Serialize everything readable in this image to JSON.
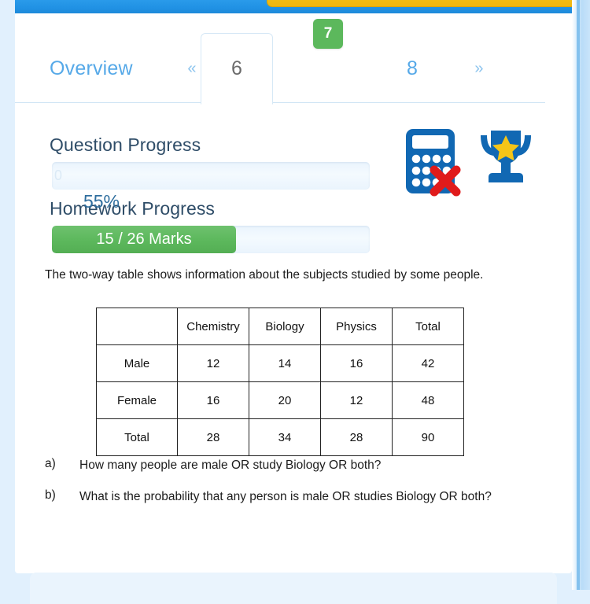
{
  "header": {
    "action_button": "",
    "bar_color": "#2091e4",
    "button_color": "#f0b90f"
  },
  "tabs": {
    "overview_label": "Overview",
    "prev_label": "«",
    "next_label": "»",
    "pages": [
      {
        "label": "6",
        "state": "active"
      },
      {
        "label": "7",
        "state": "badge"
      },
      {
        "label": "8",
        "state": "normal"
      }
    ],
    "active_color": "#6b6b6b",
    "link_color": "#56a9e8",
    "badge_color": "#5cb85c"
  },
  "progress": {
    "question": {
      "label": "Question Progress",
      "value_text": "0",
      "percent": 0
    },
    "homework": {
      "label": "Homework Progress",
      "value_text": "15 / 26 Marks",
      "marks_earned": 15,
      "marks_total": 26,
      "percent": 58
    },
    "label_color": "#2f4d68",
    "fill_color": "#5cb85c"
  },
  "status_icons": {
    "calculator": {
      "name": "calculator-not-allowed-icon",
      "allowed": false
    },
    "trophy": {
      "name": "trophy-icon"
    },
    "score_percent": "55%",
    "icon_color": "#1168b3",
    "star_color": "#f5c518",
    "cross_color": "#e01b1b"
  },
  "question": {
    "intro": "The two-way table shows information about the subjects studied by some people.",
    "table": {
      "columns": [
        "",
        "Chemistry",
        "Biology",
        "Physics",
        "Total"
      ],
      "rows": [
        {
          "header": "Male",
          "cells": [
            "12",
            "14",
            "16",
            "42"
          ]
        },
        {
          "header": "Female",
          "cells": [
            "16",
            "20",
            "12",
            "48"
          ]
        },
        {
          "header": "Total",
          "cells": [
            "28",
            "34",
            "28",
            "90"
          ]
        }
      ]
    },
    "parts": [
      {
        "label": "a)",
        "text": "How many people are male OR study Biology OR both?"
      },
      {
        "label": "b)",
        "text": "What is the probability that any person is male OR studies Biology OR both?"
      }
    ]
  }
}
